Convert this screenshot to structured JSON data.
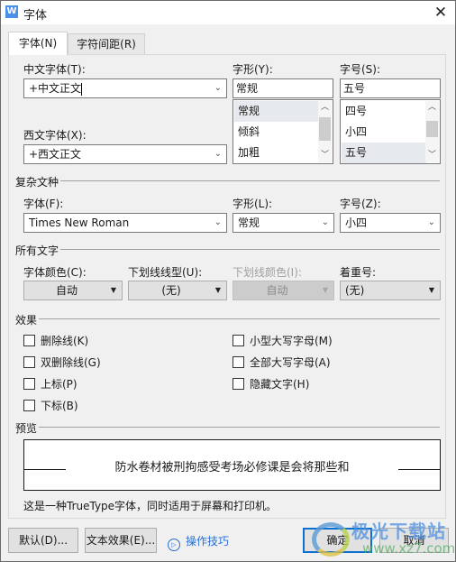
{
  "window": {
    "title": "字体",
    "app_icon": "W",
    "close_label": "✕"
  },
  "tabs": [
    {
      "label": "字体(N)",
      "active": true
    },
    {
      "label": "字符间距(R)",
      "active": false
    }
  ],
  "font_tab": {
    "chinese_font": {
      "label": "中文字体(T):",
      "value": "+中文正文"
    },
    "style": {
      "label": "字形(Y):",
      "value": "常规",
      "options": [
        "常规",
        "倾斜",
        "加粗"
      ],
      "selected": "常规"
    },
    "size": {
      "label": "字号(S):",
      "value": "五号",
      "options": [
        "四号",
        "小四",
        "五号"
      ],
      "selected": "五号"
    },
    "western_font": {
      "label": "西文字体(X):",
      "value": "+西文正文"
    },
    "complex": {
      "section_title": "复杂文种",
      "font": {
        "label": "字体(F):",
        "value": "Times New Roman"
      },
      "style": {
        "label": "字形(L):",
        "value": "常规"
      },
      "size": {
        "label": "字号(Z):",
        "value": "小四"
      }
    },
    "all_text": {
      "section_title": "所有文字",
      "font_color": {
        "label": "字体颜色(C):",
        "value": "自动"
      },
      "underline_type": {
        "label": "下划线线型(U):",
        "value": "(无)"
      },
      "underline_color": {
        "label": "下划线颜色(I):",
        "value": "自动",
        "disabled": true
      },
      "emphasis": {
        "label": "着重号:",
        "value": "(无)"
      }
    },
    "effects": {
      "section_title": "效果",
      "left": [
        {
          "label": "删除线(K)",
          "checked": false
        },
        {
          "label": "双删除线(G)",
          "checked": false
        },
        {
          "label": "上标(P)",
          "checked": false
        },
        {
          "label": "下标(B)",
          "checked": false
        }
      ],
      "right": [
        {
          "label": "小型大写字母(M)",
          "checked": false
        },
        {
          "label": "全部大写字母(A)",
          "checked": false
        },
        {
          "label": "隐藏文字(H)",
          "checked": false
        }
      ]
    },
    "preview": {
      "section_title": "预览",
      "sample_text": "防水卷材被刑拘感受考场必修课是会将那些和",
      "description": "这是一种TrueType字体，同时适用于屏幕和打印机。"
    }
  },
  "footer": {
    "default_button": "默认(D)...",
    "text_effects_button": "文本效果(E)...",
    "tips_link": "操作技巧",
    "ok_button": "确定",
    "cancel_button": "取消"
  },
  "watermark": {
    "title": "极光下载站",
    "url": "www.xz7.com"
  },
  "icons": {
    "chevron_down": "⌄",
    "triangle_down": "▼",
    "scroll_up": "▲",
    "scroll_down": "▼",
    "play": "▷"
  }
}
